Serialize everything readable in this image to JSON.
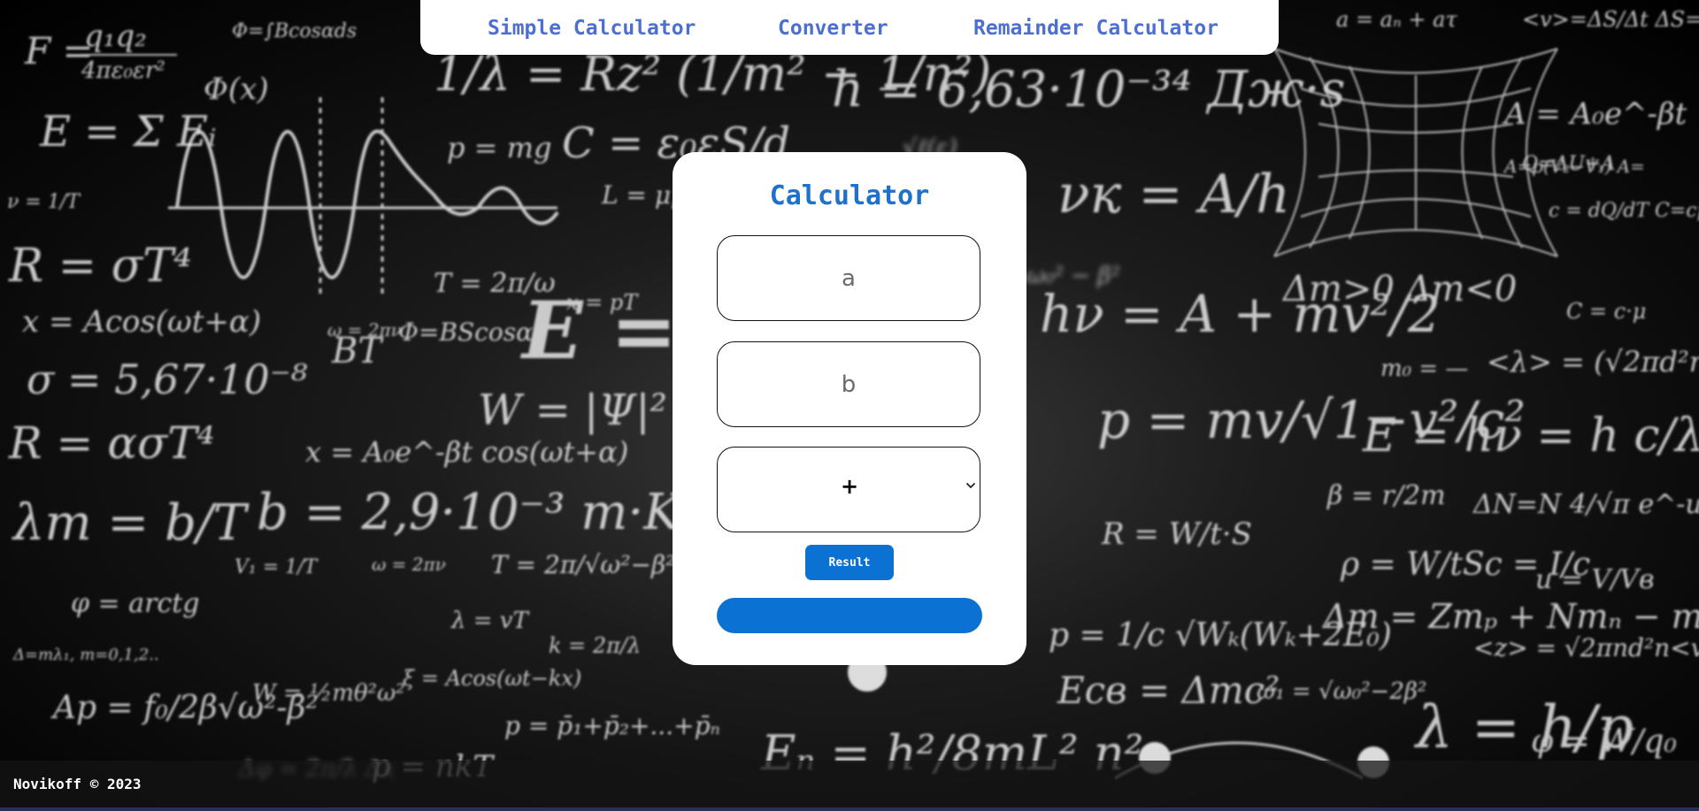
{
  "nav": {
    "links": [
      "Simple Calculator",
      "Converter",
      "Remainder Calculator"
    ]
  },
  "calculator": {
    "title": "Calculator",
    "input_a": {
      "placeholder": "a",
      "value": ""
    },
    "input_b": {
      "placeholder": "b",
      "value": ""
    },
    "operation": {
      "selected": "+"
    },
    "result_button": "Result",
    "output": ""
  },
  "footer": {
    "copyright": "Novikoff © 2023"
  },
  "colors": {
    "accent": "#0b72d4",
    "nav_link": "#4d6fd0",
    "title": "#1f72c9"
  }
}
